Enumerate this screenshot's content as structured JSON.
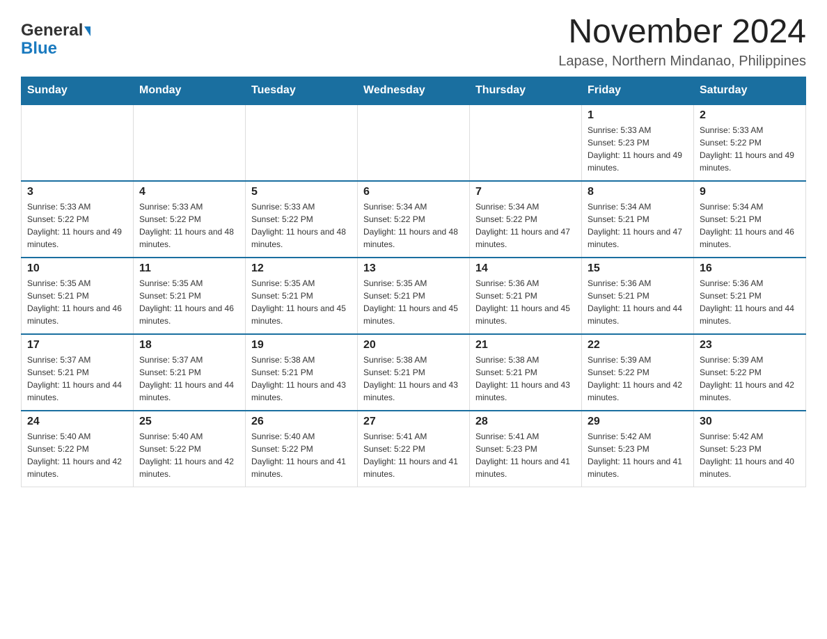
{
  "header": {
    "logo_general": "General",
    "logo_blue": "Blue",
    "title": "November 2024",
    "subtitle": "Lapase, Northern Mindanao, Philippines"
  },
  "calendar": {
    "days_of_week": [
      "Sunday",
      "Monday",
      "Tuesday",
      "Wednesday",
      "Thursday",
      "Friday",
      "Saturday"
    ],
    "weeks": [
      [
        {
          "day": "",
          "info": ""
        },
        {
          "day": "",
          "info": ""
        },
        {
          "day": "",
          "info": ""
        },
        {
          "day": "",
          "info": ""
        },
        {
          "day": "",
          "info": ""
        },
        {
          "day": "1",
          "info": "Sunrise: 5:33 AM\nSunset: 5:23 PM\nDaylight: 11 hours and 49 minutes."
        },
        {
          "day": "2",
          "info": "Sunrise: 5:33 AM\nSunset: 5:22 PM\nDaylight: 11 hours and 49 minutes."
        }
      ],
      [
        {
          "day": "3",
          "info": "Sunrise: 5:33 AM\nSunset: 5:22 PM\nDaylight: 11 hours and 49 minutes."
        },
        {
          "day": "4",
          "info": "Sunrise: 5:33 AM\nSunset: 5:22 PM\nDaylight: 11 hours and 48 minutes."
        },
        {
          "day": "5",
          "info": "Sunrise: 5:33 AM\nSunset: 5:22 PM\nDaylight: 11 hours and 48 minutes."
        },
        {
          "day": "6",
          "info": "Sunrise: 5:34 AM\nSunset: 5:22 PM\nDaylight: 11 hours and 48 minutes."
        },
        {
          "day": "7",
          "info": "Sunrise: 5:34 AM\nSunset: 5:22 PM\nDaylight: 11 hours and 47 minutes."
        },
        {
          "day": "8",
          "info": "Sunrise: 5:34 AM\nSunset: 5:21 PM\nDaylight: 11 hours and 47 minutes."
        },
        {
          "day": "9",
          "info": "Sunrise: 5:34 AM\nSunset: 5:21 PM\nDaylight: 11 hours and 46 minutes."
        }
      ],
      [
        {
          "day": "10",
          "info": "Sunrise: 5:35 AM\nSunset: 5:21 PM\nDaylight: 11 hours and 46 minutes."
        },
        {
          "day": "11",
          "info": "Sunrise: 5:35 AM\nSunset: 5:21 PM\nDaylight: 11 hours and 46 minutes."
        },
        {
          "day": "12",
          "info": "Sunrise: 5:35 AM\nSunset: 5:21 PM\nDaylight: 11 hours and 45 minutes."
        },
        {
          "day": "13",
          "info": "Sunrise: 5:35 AM\nSunset: 5:21 PM\nDaylight: 11 hours and 45 minutes."
        },
        {
          "day": "14",
          "info": "Sunrise: 5:36 AM\nSunset: 5:21 PM\nDaylight: 11 hours and 45 minutes."
        },
        {
          "day": "15",
          "info": "Sunrise: 5:36 AM\nSunset: 5:21 PM\nDaylight: 11 hours and 44 minutes."
        },
        {
          "day": "16",
          "info": "Sunrise: 5:36 AM\nSunset: 5:21 PM\nDaylight: 11 hours and 44 minutes."
        }
      ],
      [
        {
          "day": "17",
          "info": "Sunrise: 5:37 AM\nSunset: 5:21 PM\nDaylight: 11 hours and 44 minutes."
        },
        {
          "day": "18",
          "info": "Sunrise: 5:37 AM\nSunset: 5:21 PM\nDaylight: 11 hours and 44 minutes."
        },
        {
          "day": "19",
          "info": "Sunrise: 5:38 AM\nSunset: 5:21 PM\nDaylight: 11 hours and 43 minutes."
        },
        {
          "day": "20",
          "info": "Sunrise: 5:38 AM\nSunset: 5:21 PM\nDaylight: 11 hours and 43 minutes."
        },
        {
          "day": "21",
          "info": "Sunrise: 5:38 AM\nSunset: 5:21 PM\nDaylight: 11 hours and 43 minutes."
        },
        {
          "day": "22",
          "info": "Sunrise: 5:39 AM\nSunset: 5:22 PM\nDaylight: 11 hours and 42 minutes."
        },
        {
          "day": "23",
          "info": "Sunrise: 5:39 AM\nSunset: 5:22 PM\nDaylight: 11 hours and 42 minutes."
        }
      ],
      [
        {
          "day": "24",
          "info": "Sunrise: 5:40 AM\nSunset: 5:22 PM\nDaylight: 11 hours and 42 minutes."
        },
        {
          "day": "25",
          "info": "Sunrise: 5:40 AM\nSunset: 5:22 PM\nDaylight: 11 hours and 42 minutes."
        },
        {
          "day": "26",
          "info": "Sunrise: 5:40 AM\nSunset: 5:22 PM\nDaylight: 11 hours and 41 minutes."
        },
        {
          "day": "27",
          "info": "Sunrise: 5:41 AM\nSunset: 5:22 PM\nDaylight: 11 hours and 41 minutes."
        },
        {
          "day": "28",
          "info": "Sunrise: 5:41 AM\nSunset: 5:23 PM\nDaylight: 11 hours and 41 minutes."
        },
        {
          "day": "29",
          "info": "Sunrise: 5:42 AM\nSunset: 5:23 PM\nDaylight: 11 hours and 41 minutes."
        },
        {
          "day": "30",
          "info": "Sunrise: 5:42 AM\nSunset: 5:23 PM\nDaylight: 11 hours and 40 minutes."
        }
      ]
    ]
  }
}
